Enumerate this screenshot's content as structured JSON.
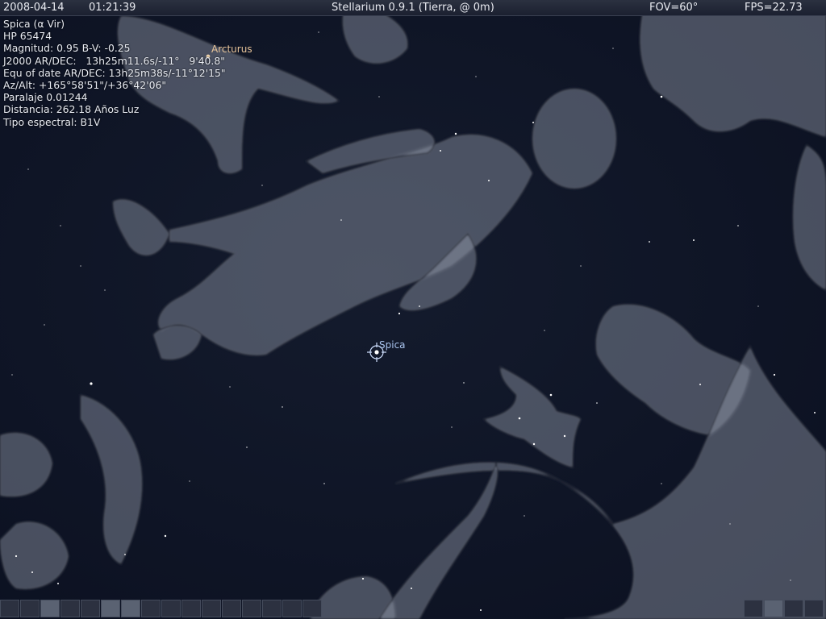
{
  "topbar": {
    "date": "2008-04-14",
    "time": "01:21:39",
    "title": "Stellarium 0.9.1 (Tierra,  @ 0m)",
    "fov": "FOV=60°",
    "fps": "FPS=22.73"
  },
  "object_info": {
    "name": "Spica (α Vir)",
    "catalog": "HP 65474",
    "magnitude": "Magnitud: 0.95 B-V: -0.25",
    "j2000": "J2000 AR/DEC:   13h25m11.6s/-11°   9'40.8\"",
    "equ_of_date": "Equ of date AR/DEC: 13h25m38s/-11°12'15\"",
    "az_alt": "Az/Alt: +165°58'51\"/+36°42'06\"",
    "parallax": "Paralaje 0.01244",
    "distance": "Distancia: 262.18 Años Luz",
    "spectral_type": "Tipo espectral: B1V"
  },
  "labels": {
    "arcturus": "Arcturus",
    "spica": "Spica"
  },
  "colors": {
    "sky": "#0e1424",
    "art": "#9aa1b3",
    "arcturus_label": "#e8c49a",
    "spica_label": "#a9c4ee"
  },
  "bottombar": {
    "left_buttons": 16,
    "right_buttons": 4
  }
}
